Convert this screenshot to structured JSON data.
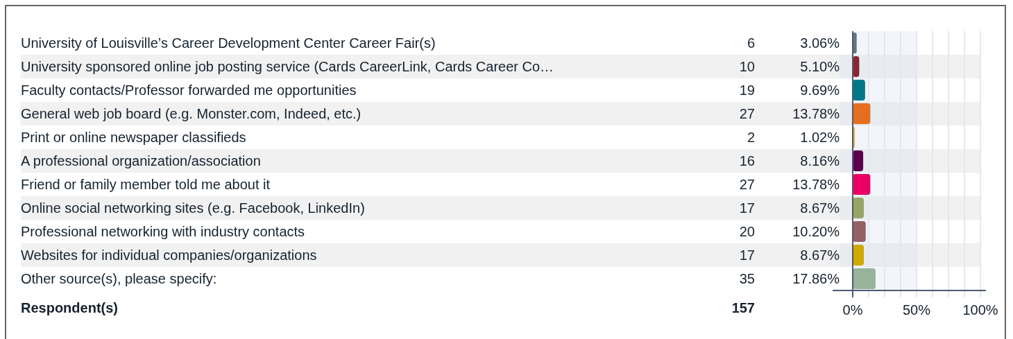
{
  "rows": [
    {
      "label": "University of Louisville’s Career Development Center Career Fair(s)",
      "count": "6",
      "percent": "3.06%",
      "color": "#647481"
    },
    {
      "label": "University sponsored online job posting service (Cards CareerLink, Cards Career Co…",
      "count": "10",
      "percent": "5.10%",
      "color": "#8b2530"
    },
    {
      "label": "Faculty contacts/Professor forwarded me opportunities",
      "count": "19",
      "percent": "9.69%",
      "color": "#00788a"
    },
    {
      "label": "General web job board (e.g. Monster.com, Indeed, etc.)",
      "count": "27",
      "percent": "13.78%",
      "color": "#e56f1f"
    },
    {
      "label": "Print or online newspaper classifieds",
      "count": "2",
      "percent": "1.02%",
      "color": "#e3b23c"
    },
    {
      "label": "A professional organization/association",
      "count": "16",
      "percent": "8.16%",
      "color": "#5c004e"
    },
    {
      "label": "Friend or family member told me about it",
      "count": "27",
      "percent": "13.78%",
      "color": "#ea0064"
    },
    {
      "label": "Online social networking sites (e.g. Facebook, LinkedIn)",
      "count": "17",
      "percent": "8.67%",
      "color": "#97a565"
    },
    {
      "label": "Professional networking with industry contacts",
      "count": "20",
      "percent": "10.20%",
      "color": "#956262"
    },
    {
      "label": "Websites for individual companies/organizations",
      "count": "17",
      "percent": "8.67%",
      "color": "#cfa800"
    },
    {
      "label": "Other source(s), please specify:",
      "count": "35",
      "percent": "17.86%",
      "color": "#97b39a"
    }
  ],
  "footer": {
    "label": "Respondent(s)",
    "count": "157"
  },
  "chart_data": {
    "type": "bar",
    "orientation": "horizontal",
    "values": [
      3.1,
      5.1,
      9.7,
      13.8,
      1.0,
      8.2,
      13.8,
      8.7,
      10.2,
      8.7,
      17.9
    ],
    "xlim": [
      0,
      100
    ],
    "xticks": [
      {
        "value": 0,
        "label": "0%"
      },
      {
        "value": 50,
        "label": "50%"
      },
      {
        "value": 100,
        "label": "100%"
      }
    ]
  }
}
